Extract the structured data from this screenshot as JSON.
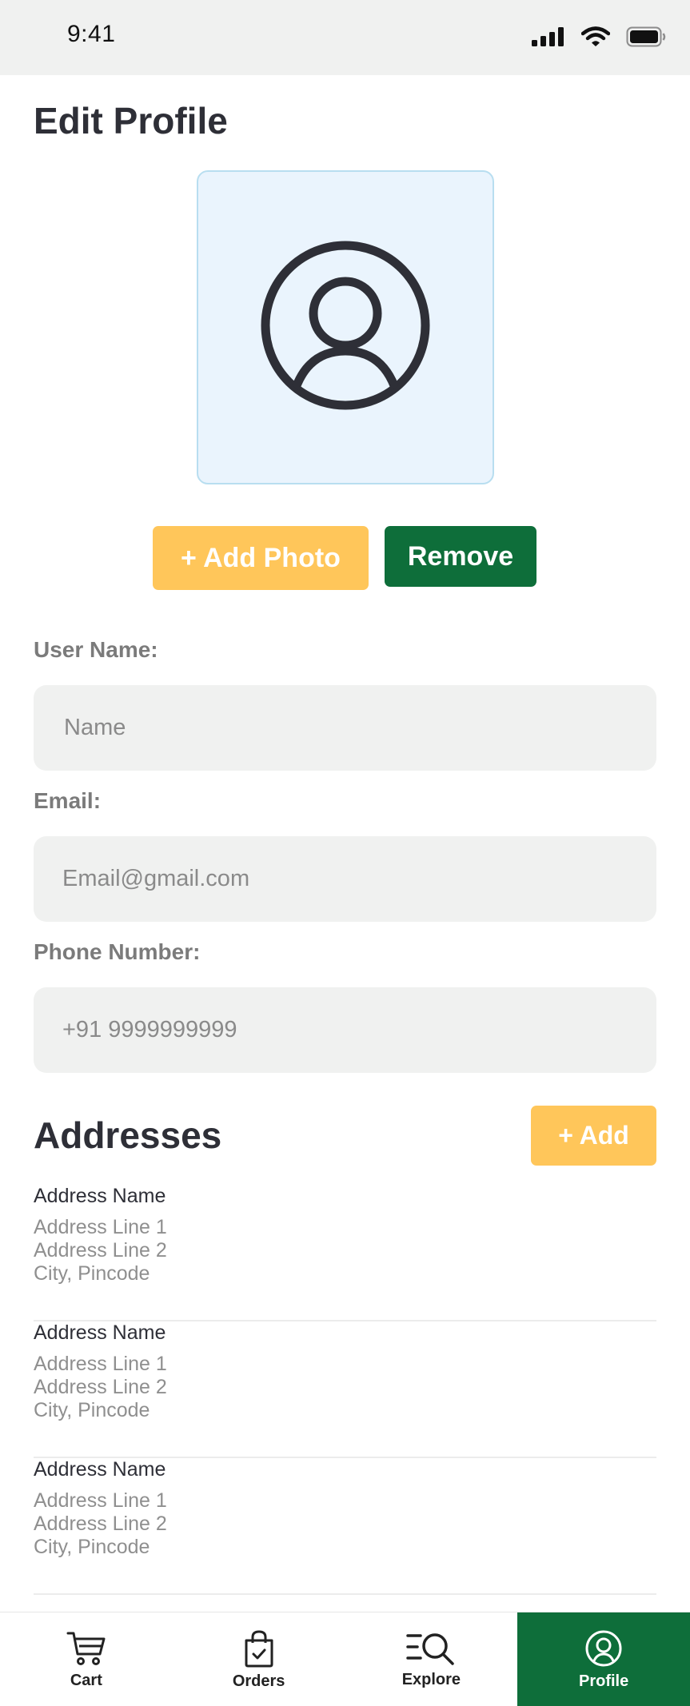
{
  "status_bar": {
    "time": "9:41",
    "icons": [
      "signal-icon",
      "wifi-icon",
      "battery-icon"
    ]
  },
  "page": {
    "title": "Edit Profile"
  },
  "avatar": {
    "icon": "user-circle-icon"
  },
  "photo_actions": {
    "add_photo_label": "+ Add Photo",
    "remove_label": "Remove"
  },
  "form": {
    "username": {
      "label": "User Name:",
      "placeholder": "Name",
      "value": ""
    },
    "email": {
      "label": "Email:",
      "placeholder": "Email@gmail.com",
      "value": ""
    },
    "phone": {
      "label": "Phone Number:",
      "placeholder": "+91 9999999999",
      "value": ""
    }
  },
  "addresses": {
    "title": "Addresses",
    "add_label": "+ Add",
    "items": [
      {
        "name": "Address Name",
        "line1": "Address Line 1",
        "line2": "Address Line 2",
        "city": "City, Pincode"
      },
      {
        "name": "Address Name",
        "line1": "Address Line 1",
        "line2": "Address Line 2",
        "city": "City, Pincode"
      },
      {
        "name": "Address Name",
        "line1": "Address Line 1",
        "line2": "Address Line 2",
        "city": "City, Pincode"
      }
    ]
  },
  "tab_bar": {
    "tabs": [
      {
        "label": "Cart",
        "icon": "cart-icon",
        "active": false
      },
      {
        "label": "Orders",
        "icon": "shopping-bag-icon",
        "active": false
      },
      {
        "label": "Explore",
        "icon": "explore-search-icon",
        "active": false
      },
      {
        "label": "Profile",
        "icon": "profile-icon",
        "active": true
      }
    ]
  },
  "colors": {
    "primary_green": "#0e6e3a",
    "accent_yellow": "#ffc65a",
    "input_bg": "#f0f1f0",
    "avatar_bg": "#eaf4fd"
  }
}
